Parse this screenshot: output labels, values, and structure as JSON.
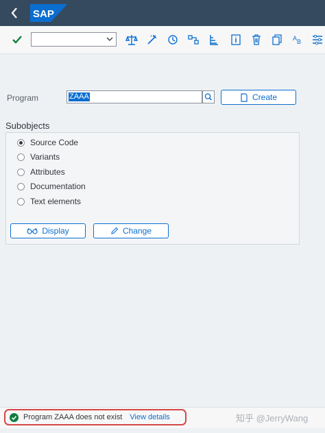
{
  "header": {
    "logo_text": "SAP",
    "brand_color": "#0a6ed1",
    "back_icon": "chevron-left-icon"
  },
  "toolbar": {
    "command_field_value": "",
    "icons": [
      "checkmark-icon",
      "balance-icon",
      "magic-wand-icon",
      "history-icon",
      "where-used-icon",
      "hierarchy-icon",
      "info-icon",
      "trash-icon",
      "copy-icon",
      "text-ab-icon",
      "settings-icon"
    ]
  },
  "form": {
    "program_label": "Program",
    "program_value": "ZAAA",
    "create_label": "Create"
  },
  "subobjects": {
    "title": "Subobjects",
    "options": [
      "Source Code",
      "Variants",
      "Attributes",
      "Documentation",
      "Text elements"
    ],
    "selected": "Source Code",
    "display_label": "Display",
    "change_label": "Change"
  },
  "status": {
    "message": "Program ZAAA does not exist",
    "link": "View details",
    "success_color": "#107e3e",
    "highlight_color": "#d64545"
  },
  "watermark": "知乎 @JerryWang"
}
